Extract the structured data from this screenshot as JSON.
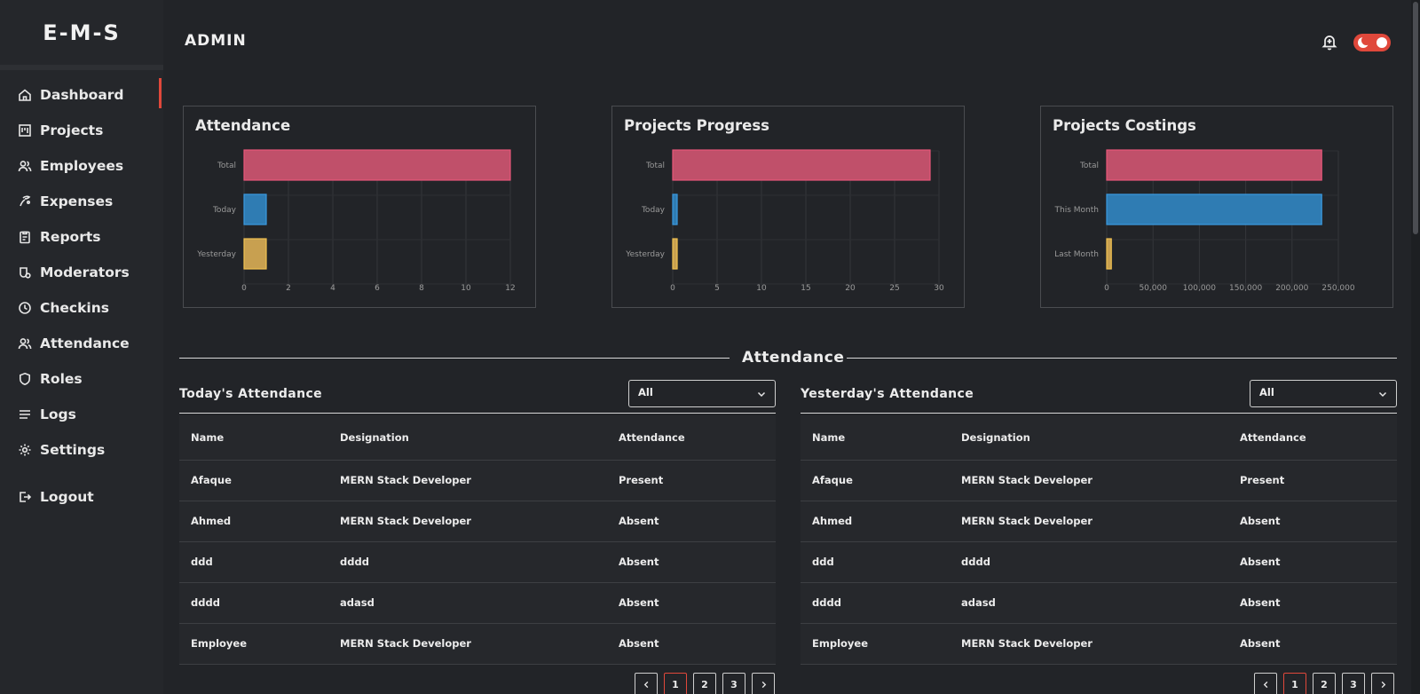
{
  "app": {
    "brand": "E-M-S",
    "page_title": "ADMIN"
  },
  "sidebar": {
    "items": [
      {
        "label": "Dashboard",
        "icon": "home-icon",
        "active": true
      },
      {
        "label": "Projects",
        "icon": "kanban-icon"
      },
      {
        "label": "Employees",
        "icon": "users-icon"
      },
      {
        "label": "Expenses",
        "icon": "money-hand-icon"
      },
      {
        "label": "Reports",
        "icon": "clipboard-icon"
      },
      {
        "label": "Moderators",
        "icon": "moderator-icon"
      },
      {
        "label": "Checkins",
        "icon": "clock-icon"
      },
      {
        "label": "Attendance",
        "icon": "users-icon"
      },
      {
        "label": "Roles",
        "icon": "shield-icon"
      },
      {
        "label": "Logs",
        "icon": "list-icon"
      },
      {
        "label": "Settings",
        "icon": "gear-icon"
      }
    ],
    "logout": {
      "label": "Logout",
      "icon": "logout-icon"
    }
  },
  "topbar": {
    "notification_icon": "bell-plus-icon",
    "theme_toggle_icon": "moon-toggle-icon"
  },
  "colors": {
    "accent": "#e0483b",
    "bar_pink": "#c0506a",
    "bar_pink_border": "#e8567a",
    "bar_blue": "#2f7cb3",
    "bar_blue_border": "#3a9ae0",
    "bar_gold": "#c8a050",
    "bar_gold_border": "#f0c050"
  },
  "chart_data": [
    {
      "type": "bar",
      "orientation": "horizontal",
      "title": "Attendance",
      "categories": [
        "Total",
        "Today",
        "Yesterday"
      ],
      "values": [
        12,
        1,
        1
      ],
      "xlim": [
        0,
        12
      ],
      "xticks": [
        "0",
        "2",
        "4",
        "6",
        "8",
        "10",
        "12"
      ],
      "grid": true
    },
    {
      "type": "bar",
      "orientation": "horizontal",
      "title": "Projects Progress",
      "categories": [
        "Total",
        "Today",
        "Yesterday"
      ],
      "values": [
        29,
        0.5,
        0.5
      ],
      "xlim": [
        0,
        30
      ],
      "xticks": [
        "0",
        "5",
        "10",
        "15",
        "20",
        "25",
        "30"
      ],
      "grid": true
    },
    {
      "type": "bar",
      "orientation": "horizontal",
      "title": "Projects Costings",
      "categories": [
        "Total",
        "This Month",
        "Last Month"
      ],
      "values": [
        232000,
        232000,
        5000
      ],
      "xlim": [
        0,
        250000
      ],
      "xticks": [
        "0",
        "50,000",
        "100,000",
        "150,000",
        "200,000",
        "250,000"
      ],
      "grid": true
    }
  ],
  "attendance": {
    "section_title": "Attendance",
    "today": {
      "title": "Today's Attendance",
      "filter": "All",
      "columns": [
        "Name",
        "Designation",
        "Attendance"
      ],
      "rows": [
        [
          "Afaque",
          "MERN Stack Developer",
          "Present"
        ],
        [
          "Ahmed",
          "MERN Stack Developer",
          "Absent"
        ],
        [
          "ddd",
          "dddd",
          "Absent"
        ],
        [
          "dddd",
          "adasd",
          "Absent"
        ],
        [
          "Employee",
          "MERN Stack Developer",
          "Absent"
        ]
      ],
      "pages": [
        "1",
        "2",
        "3"
      ],
      "current_page": "1"
    },
    "yesterday": {
      "title": "Yesterday's Attendance",
      "filter": "All",
      "columns": [
        "Name",
        "Designation",
        "Attendance"
      ],
      "rows": [
        [
          "Afaque",
          "MERN Stack Developer",
          "Present"
        ],
        [
          "Ahmed",
          "MERN Stack Developer",
          "Absent"
        ],
        [
          "ddd",
          "dddd",
          "Absent"
        ],
        [
          "dddd",
          "adasd",
          "Absent"
        ],
        [
          "Employee",
          "MERN Stack Developer",
          "Absent"
        ]
      ],
      "pages": [
        "1",
        "2",
        "3"
      ],
      "current_page": "1"
    }
  }
}
